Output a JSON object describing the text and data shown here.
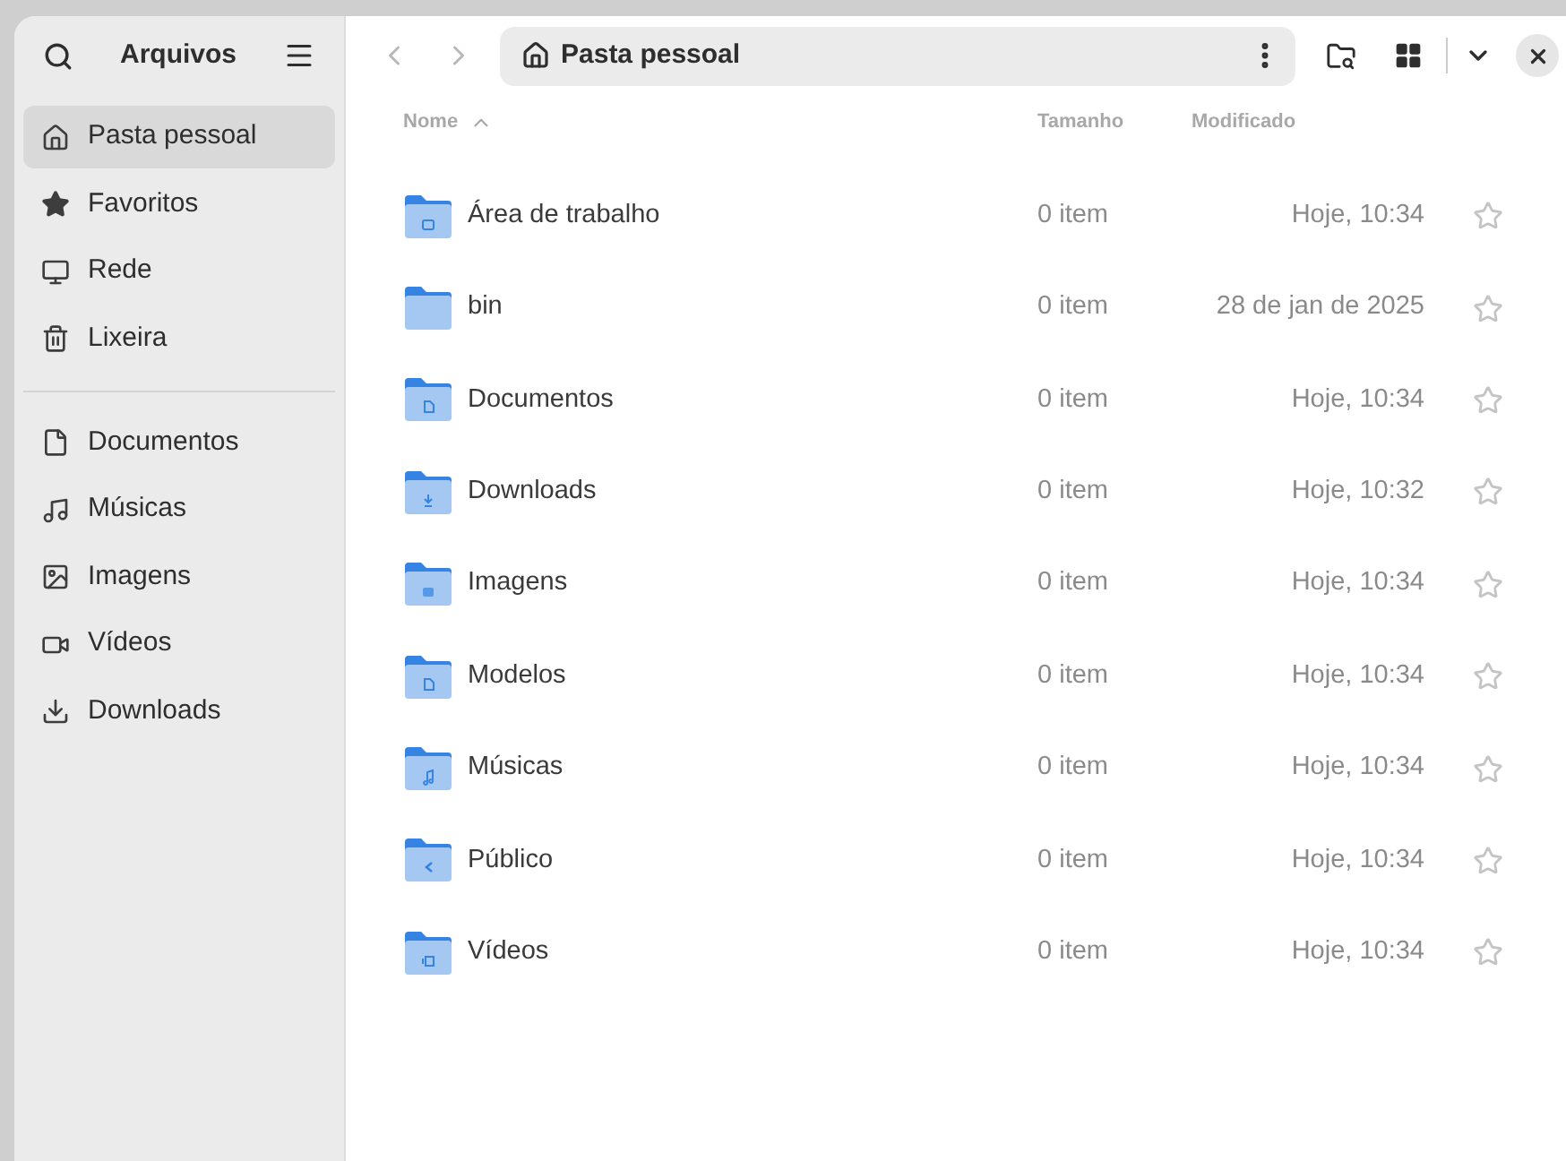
{
  "sidebar": {
    "title": "Arquivos",
    "places": [
      {
        "label": "Pasta pessoal",
        "kind": "home",
        "selected": true
      },
      {
        "label": "Favoritos",
        "kind": "starred",
        "selected": false
      },
      {
        "label": "Rede",
        "kind": "network",
        "selected": false
      },
      {
        "label": "Lixeira",
        "kind": "trash",
        "selected": false
      }
    ],
    "bookmarks": [
      {
        "label": "Documentos",
        "kind": "document",
        "selected": false
      },
      {
        "label": "Músicas",
        "kind": "music",
        "selected": false
      },
      {
        "label": "Imagens",
        "kind": "image",
        "selected": false
      },
      {
        "label": "Vídeos",
        "kind": "video",
        "selected": false
      },
      {
        "label": "Downloads",
        "kind": "download",
        "selected": false
      }
    ]
  },
  "path_bar": {
    "location": "Pasta pessoal"
  },
  "table": {
    "columns": [
      "Nome",
      "Tamanho",
      "Modificado"
    ],
    "rows": [
      {
        "name": "Área de trabalho",
        "kind": "desktop",
        "size": "0 item",
        "modified": "Hoje, 10:34",
        "starred": false
      },
      {
        "name": "bin",
        "kind": "plain",
        "size": "0 item",
        "modified": "28 de jan de 2025",
        "starred": false
      },
      {
        "name": "Documentos",
        "kind": "document",
        "size": "0 item",
        "modified": "Hoje, 10:34",
        "starred": false
      },
      {
        "name": "Downloads",
        "kind": "download",
        "size": "0 item",
        "modified": "Hoje, 10:32",
        "starred": false
      },
      {
        "name": "Imagens",
        "kind": "image",
        "size": "0 item",
        "modified": "Hoje, 10:34",
        "starred": false
      },
      {
        "name": "Modelos",
        "kind": "document",
        "size": "0 item",
        "modified": "Hoje, 10:34",
        "starred": false
      },
      {
        "name": "Músicas",
        "kind": "music",
        "size": "0 item",
        "modified": "Hoje, 10:34",
        "starred": false
      },
      {
        "name": "Público",
        "kind": "share",
        "size": "0 item",
        "modified": "Hoje, 10:34",
        "starred": false
      },
      {
        "name": "Vídeos",
        "kind": "video",
        "size": "0 item",
        "modified": "Hoje, 10:34",
        "starred": false
      }
    ]
  }
}
